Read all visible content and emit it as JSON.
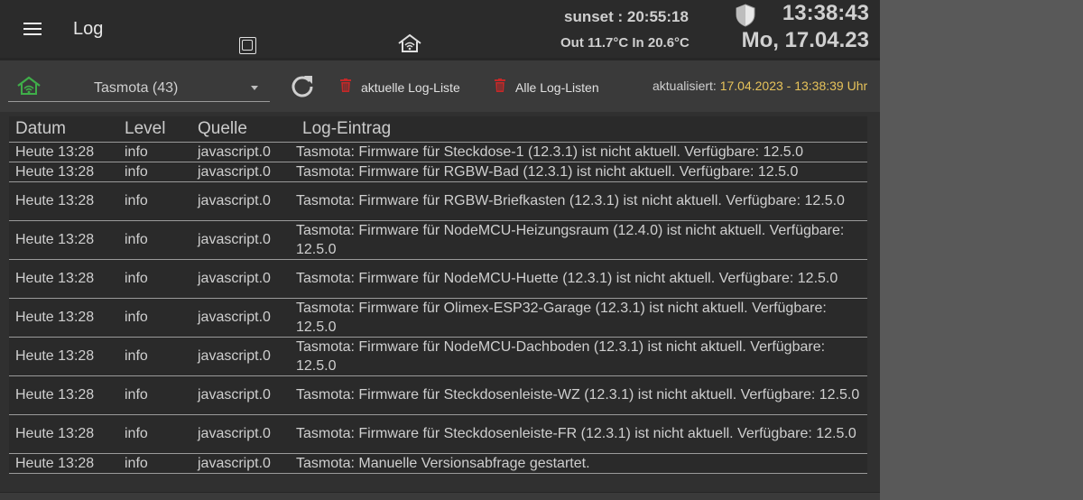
{
  "header": {
    "title": "Log",
    "sunset": "sunset : 20:55:18",
    "temps": "Out 11.7°C In 20.6°C",
    "time": "13:38:43",
    "date": "Mo, 17.04.23"
  },
  "toolbar": {
    "adapter_select": "Tasmota (43)",
    "delete_current_label": "aktuelle Log-Liste",
    "delete_all_label": "Alle Log-Listen",
    "updated_label": "aktualisiert: ",
    "updated_value": "17.04.2023 - 13:38:39 Uhr"
  },
  "colors": {
    "accent_yellow": "#e6c25a",
    "delete_red": "#c62828",
    "tasmota_green": "#3fae49"
  },
  "table": {
    "headers": [
      "Datum",
      "Level",
      "Quelle",
      "Log-Eintrag"
    ],
    "rows": [
      {
        "datum": "Heute 13:28",
        "level": "info",
        "quelle": "javascript.0",
        "msg": "Tasmota: Firmware für Steckdose-1 (12.3.1) ist nicht aktuell. Verfügbare: 12.5.0",
        "lines": 1
      },
      {
        "datum": "Heute 13:28",
        "level": "info",
        "quelle": "javascript.0",
        "msg": "Tasmota: Firmware für RGBW-Bad (12.3.1) ist nicht aktuell. Verfügbare: 12.5.0",
        "lines": 1
      },
      {
        "datum": "Heute 13:28",
        "level": "info",
        "quelle": "javascript.0",
        "msg": "Tasmota: Firmware für RGBW-Briefkasten (12.3.1) ist nicht aktuell. Verfügbare: 12.5.0",
        "lines": 2
      },
      {
        "datum": "Heute 13:28",
        "level": "info",
        "quelle": "javascript.0",
        "msg": "Tasmota: Firmware für NodeMCU-Heizungsraum (12.4.0) ist nicht aktuell. Verfügbare: 12.5.0",
        "lines": 2
      },
      {
        "datum": "Heute 13:28",
        "level": "info",
        "quelle": "javascript.0",
        "msg": "Tasmota: Firmware für NodeMCU-Huette (12.3.1) ist nicht aktuell. Verfügbare: 12.5.0",
        "lines": 2
      },
      {
        "datum": "Heute 13:28",
        "level": "info",
        "quelle": "javascript.0",
        "msg": "Tasmota: Firmware für Olimex-ESP32-Garage (12.3.1) ist nicht aktuell. Verfügbare: 12.5.0",
        "lines": 2
      },
      {
        "datum": "Heute 13:28",
        "level": "info",
        "quelle": "javascript.0",
        "msg": "Tasmota: Firmware für NodeMCU-Dachboden (12.3.1) ist nicht aktuell. Verfügbare: 12.5.0",
        "lines": 2
      },
      {
        "datum": "Heute 13:28",
        "level": "info",
        "quelle": "javascript.0",
        "msg": "Tasmota: Firmware für Steckdosenleiste-WZ (12.3.1) ist nicht aktuell. Verfügbare: 12.5.0",
        "lines": 2
      },
      {
        "datum": "Heute 13:28",
        "level": "info",
        "quelle": "javascript.0",
        "msg": "Tasmota: Firmware für Steckdosenleiste-FR (12.3.1) ist nicht aktuell. Verfügbare: 12.5.0",
        "lines": 2
      },
      {
        "datum": "Heute 13:28",
        "level": "info",
        "quelle": "javascript.0",
        "msg": "Tasmota: Manuelle Versionsabfrage gestartet.",
        "lines": 1
      }
    ]
  }
}
